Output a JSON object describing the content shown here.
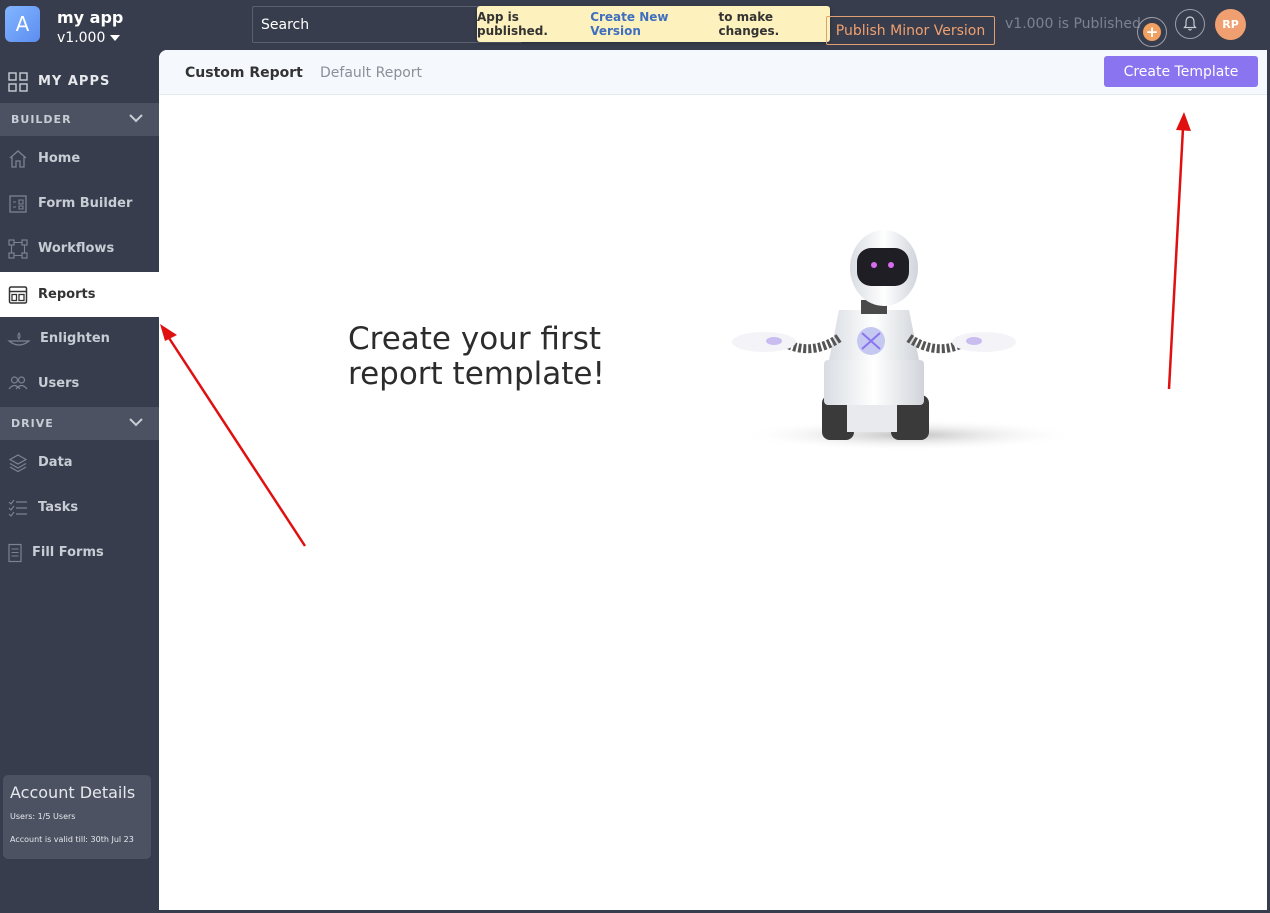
{
  "header": {
    "app_logo_letter": "A",
    "app_name": "my app",
    "app_version": "v1.000",
    "search_placeholder": "Search",
    "notice": {
      "prefix": "App is published.",
      "link": "Create New Version",
      "suffix": "to make changes."
    },
    "publish_button": "Publish Minor Version",
    "published_status": "v1.000 is Published",
    "plus_label": "+",
    "avatar_initials": "RP"
  },
  "sidebar": {
    "my_apps": "MY APPS",
    "sections": [
      {
        "title": "BUILDER",
        "items": [
          {
            "label": "Home",
            "icon": "home-icon"
          },
          {
            "label": "Form Builder",
            "icon": "form-icon"
          },
          {
            "label": "Workflows",
            "icon": "workflow-icon"
          },
          {
            "label": "Reports",
            "icon": "report-icon",
            "active": true
          },
          {
            "label": "Enlighten",
            "icon": "lamp-icon"
          },
          {
            "label": "Users",
            "icon": "users-icon"
          }
        ]
      },
      {
        "title": "DRIVE",
        "items": [
          {
            "label": "Data",
            "icon": "layers-icon"
          },
          {
            "label": "Tasks",
            "icon": "tasks-icon"
          },
          {
            "label": "Fill Forms",
            "icon": "document-icon"
          }
        ]
      }
    ],
    "account": {
      "title": "Account Details",
      "users": "Users: 1/5 Users",
      "valid_till": "Account is valid till: 30th Jul 23"
    }
  },
  "main": {
    "tabs": [
      {
        "label": "Custom Report",
        "active": true
      },
      {
        "label": "Default Report",
        "active": false
      }
    ],
    "create_button": "Create Template",
    "empty_state": {
      "line1": "Create your first",
      "line2": "report template!"
    }
  },
  "colors": {
    "sidebar_bg": "#373d4c",
    "section_bg": "#4d5262",
    "accent_purple": "#8b74f0",
    "publish_orange": "#f0a070",
    "notice_bg": "#fdf1bd",
    "annotation_red": "#e01010"
  }
}
